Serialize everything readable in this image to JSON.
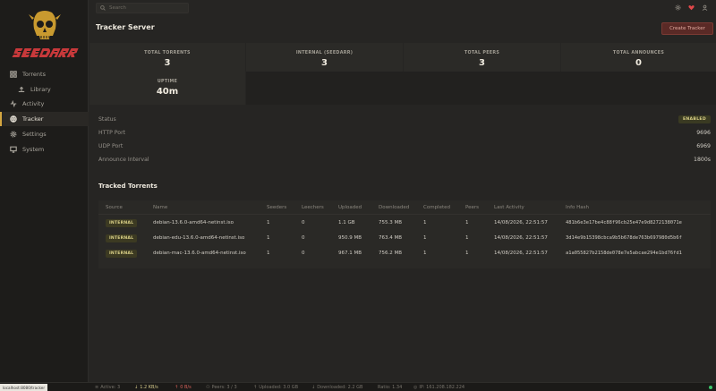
{
  "app": {
    "brand": "SEEDARR",
    "colors": {
      "accent": "#d4a640",
      "danger": "#e0484a",
      "enabled": "#d8cf86",
      "online": "#3cc46a"
    }
  },
  "sidebar": {
    "items": [
      {
        "label": "Torrents",
        "icon": "grid-icon"
      },
      {
        "label": "Library",
        "icon": "upload-icon"
      },
      {
        "label": "Activity",
        "icon": "activity-icon"
      },
      {
        "label": "Tracker",
        "icon": "globe-icon"
      },
      {
        "label": "Settings",
        "icon": "gear-icon"
      },
      {
        "label": "System",
        "icon": "monitor-icon"
      }
    ]
  },
  "topbar": {
    "search_placeholder": "Search"
  },
  "page": {
    "title": "Tracker Server",
    "create_button": "Create Tracker"
  },
  "stats": [
    {
      "label": "TOTAL TORRENTS",
      "value": "3"
    },
    {
      "label": "INTERNAL (SEEDARR)",
      "value": "3"
    },
    {
      "label": "TOTAL PEERS",
      "value": "3"
    },
    {
      "label": "TOTAL ANNOUNCES",
      "value": "0"
    },
    {
      "label": "UPTIME",
      "value": "40m"
    }
  ],
  "info": {
    "status_label": "Status",
    "status_value": "ENABLED",
    "http_label": "HTTP Port",
    "http_value": "9696",
    "udp_label": "UDP Port",
    "udp_value": "6969",
    "interval_label": "Announce Interval",
    "interval_value": "1800s"
  },
  "tracked": {
    "title": "Tracked Torrents",
    "columns": [
      "Source",
      "Name",
      "Seeders",
      "Leechers",
      "Uploaded",
      "Downloaded",
      "Completed",
      "Peers",
      "Last Activity",
      "Info Hash"
    ],
    "rows": [
      {
        "source": "INTERNAL",
        "name": "debian-13.6.0-amd64-netinst.iso",
        "seeders": "1",
        "leechers": "0",
        "uploaded": "1.1 GB",
        "downloaded": "755.3 MB",
        "completed": "1",
        "peers": "1",
        "last": "14/08/2026, 22:51:57",
        "hash": "481b6e3e17be4c88f96cb25e47e9d8272138071e"
      },
      {
        "source": "INTERNAL",
        "name": "debian-edu-13.6.0-amd64-netinst.iso",
        "seeders": "1",
        "leechers": "0",
        "uploaded": "950.9 MB",
        "downloaded": "763.4 MB",
        "completed": "1",
        "peers": "1",
        "last": "14/08/2026, 22:51:57",
        "hash": "3d14e9b15398cbca9b5b678de763b697980d5b6f"
      },
      {
        "source": "INTERNAL",
        "name": "debian-mac-13.6.0-amd64-netinst.iso",
        "seeders": "1",
        "leechers": "0",
        "uploaded": "967.1 MB",
        "downloaded": "756.2 MB",
        "completed": "1",
        "peers": "1",
        "last": "14/08/2026, 22:51:57",
        "hash": "a1a055827b2158de078e7e5abcae294e1bd76fd1"
      }
    ]
  },
  "statusbar": {
    "url": "localhost:8080/tracker",
    "active": "Active: 3",
    "down_speed": "1.2 KB/s",
    "up_speed": "0 B/s",
    "peers": "Peers: 3 / 3",
    "uploaded": "Uploaded: 3.0 GB",
    "downloaded": "Downloaded: 2.2 GB",
    "ratio": "Ratio: 1.34",
    "ip": "IP: 161.208.182.224"
  }
}
